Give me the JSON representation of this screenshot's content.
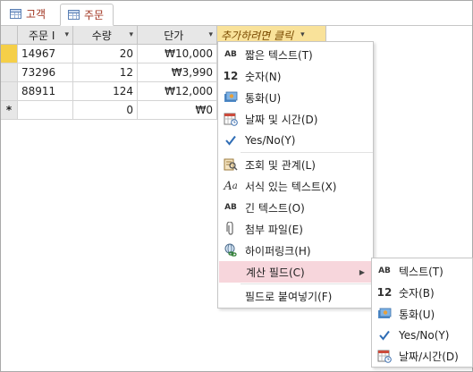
{
  "tabs": [
    {
      "label": "고객",
      "icon": "table-icon"
    },
    {
      "label": "주문",
      "icon": "table-icon"
    }
  ],
  "columns": [
    {
      "label": "주문 I",
      "align": "left"
    },
    {
      "label": "수량",
      "align": "right"
    },
    {
      "label": "단가",
      "align": "right"
    },
    {
      "label": "추가하려면 클릭",
      "align": "left"
    }
  ],
  "rows": [
    {
      "selector": "",
      "cells": [
        "14967",
        "20",
        "₩10,000"
      ]
    },
    {
      "selector": "",
      "cells": [
        "73296",
        "12",
        "₩3,990"
      ]
    },
    {
      "selector": "",
      "cells": [
        "88911",
        "124",
        "₩12,000"
      ]
    },
    {
      "selector": "*",
      "cells": [
        "",
        "0",
        "₩0"
      ]
    }
  ],
  "field_menu": {
    "items": [
      {
        "icon": "ab-short-text-icon",
        "label": "짧은 텍스트(T)"
      },
      {
        "icon": "number-icon",
        "label": "숫자(N)"
      },
      {
        "icon": "currency-icon",
        "label": "통화(U)"
      },
      {
        "icon": "calendar-icon",
        "label": "날짜 및 시간(D)"
      },
      {
        "icon": "checkbox-icon",
        "label": "Yes/No(Y)"
      },
      {
        "icon": "lookup-icon",
        "label": "조회 및 관계(L)"
      },
      {
        "icon": "rich-text-icon",
        "label": "서식 있는 텍스트(X)"
      },
      {
        "icon": "ab-long-text-icon",
        "label": "긴 텍스트(O)"
      },
      {
        "icon": "paperclip-icon",
        "label": "첨부 파일(E)"
      },
      {
        "icon": "hyperlink-icon",
        "label": "하이퍼링크(H)"
      },
      {
        "icon": "",
        "label": "계산 필드(C)"
      },
      {
        "icon": "",
        "label": "필드로 붙여넣기(F)"
      }
    ]
  },
  "sub_menu": {
    "items": [
      {
        "icon": "ab-text-icon",
        "label": "텍스트(T)"
      },
      {
        "icon": "number-icon",
        "label": "숫자(B)"
      },
      {
        "icon": "currency-icon",
        "label": "통화(U)"
      },
      {
        "icon": "checkbox-icon",
        "label": "Yes/No(Y)"
      },
      {
        "icon": "calendar-icon",
        "label": "날짜/시간(D)"
      }
    ]
  },
  "colors": {
    "accent": "#f5cf48",
    "highlight": "#f7d6dc",
    "tab_text": "#a0331f"
  }
}
